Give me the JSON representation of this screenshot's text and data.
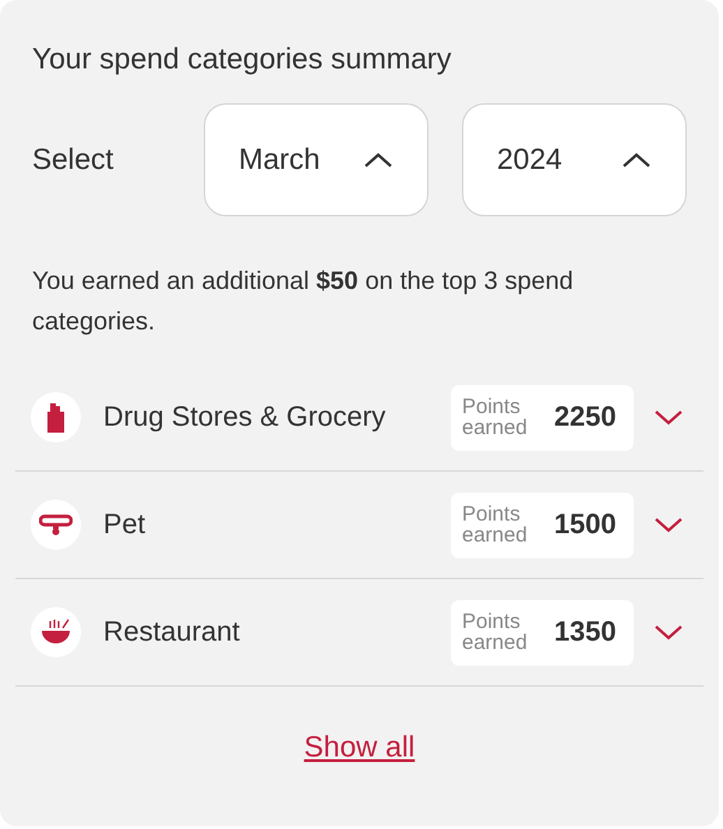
{
  "title": "Your spend categories summary",
  "select": {
    "label": "Select",
    "dropdowns": [
      {
        "value": "March",
        "expanded": true
      },
      {
        "value": "2024",
        "expanded": true
      }
    ]
  },
  "message": "You earned an additional **$50** on the top 3 spend categories.",
  "categories": [
    {
      "kind": "grocery",
      "name": "Drug Stores & Grocery",
      "points_label": "Points earned",
      "points": "2250",
      "expanded": false
    },
    {
      "kind": "pet",
      "name": "Pet",
      "points_label": "Points earned",
      "points": "1500",
      "expanded": false
    },
    {
      "kind": "restaurant",
      "name": "Restaurant",
      "points_label": "Points earned",
      "points": "1350",
      "expanded": false
    }
  ],
  "show_all": "Show all"
}
